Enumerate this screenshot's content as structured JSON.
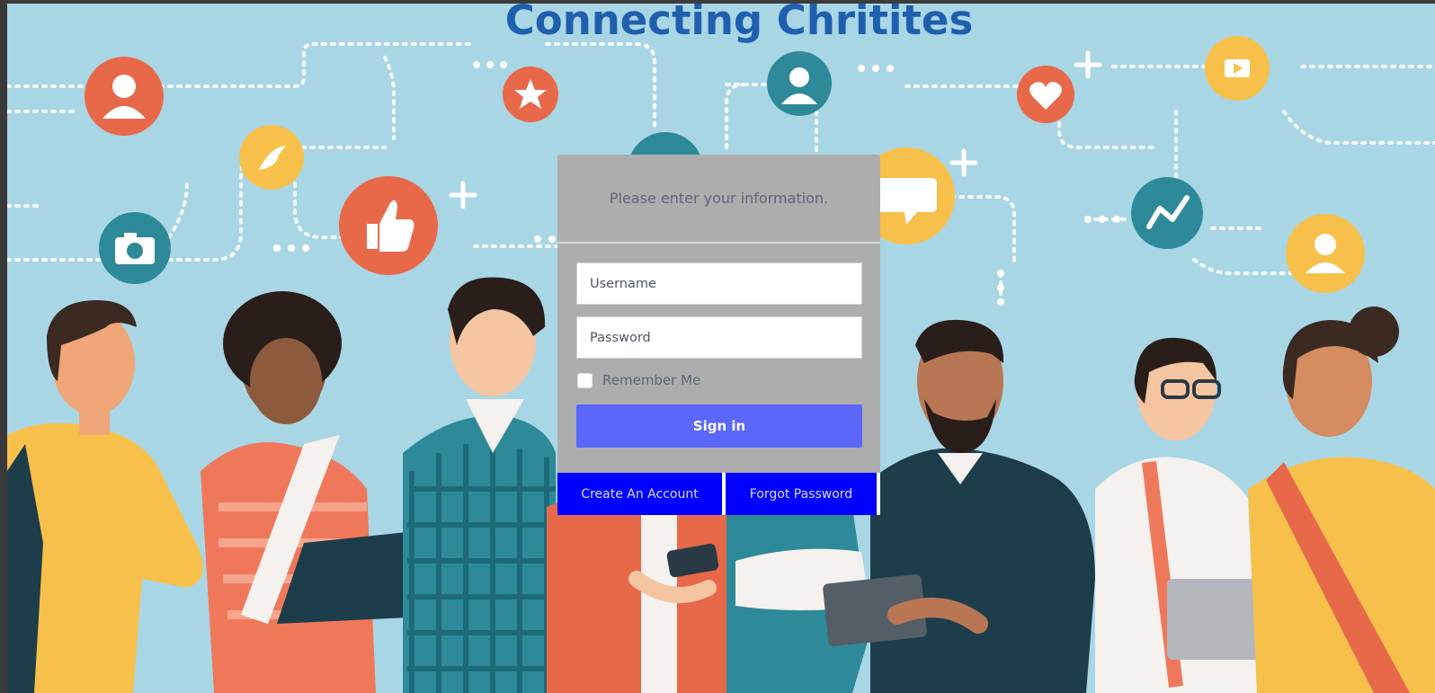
{
  "site": {
    "title": "Connecting Chritites"
  },
  "login": {
    "prompt": "Please enter your information.",
    "username_placeholder": "Username",
    "password_placeholder": "Password",
    "remember_label": "Remember Me",
    "signin_label": "Sign in",
    "create_account_label": "Create An Account",
    "forgot_password_label": "Forgot Password"
  },
  "colors": {
    "background": "#a9d6e5",
    "title": "#1f5fae",
    "card": "#adadad",
    "signin": "#5b66fb",
    "footer_buttons": "#0000ff"
  },
  "illustration_icons": [
    "user-icon",
    "star-icon",
    "user-icon",
    "heart-icon",
    "video-play-icon",
    "bird-icon",
    "thumbs-up-icon",
    "camera-icon",
    "chat-bubble-icon",
    "chart-line-icon",
    "user-icon"
  ]
}
